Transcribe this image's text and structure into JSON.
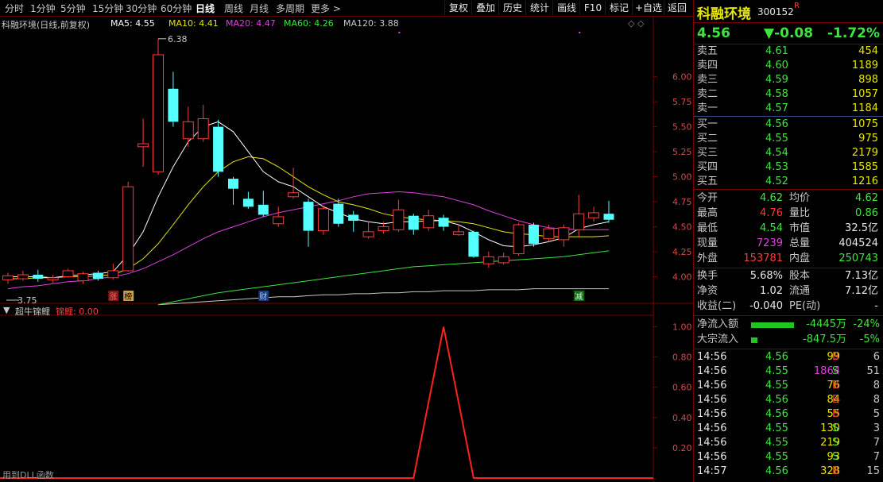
{
  "toolbar": {
    "periods": [
      "分时",
      "1分钟",
      "5分钟",
      "15分钟",
      "30分钟",
      "60分钟",
      "日线",
      "周线",
      "月线",
      "多周期",
      "更多 >"
    ],
    "active_period": "日线",
    "buttons": [
      "复权",
      "叠加",
      "历史",
      "统计",
      "画线",
      "F10",
      "标记",
      "+自选",
      "返回"
    ]
  },
  "main_chart": {
    "title": "科融环境(日线,前复权)",
    "ma": [
      {
        "label": "MA5: 4.55",
        "color": "#ffffff"
      },
      {
        "label": "MA10: 4.41",
        "color": "#e6e600"
      },
      {
        "label": "MA20: 4.47",
        "color": "#e040e0"
      },
      {
        "label": "MA60: 4.26",
        "color": "#3ce63c"
      },
      {
        "label": "MA120: 3.88",
        "color": "#c8c8c8"
      }
    ],
    "high_label": "6.38",
    "low_label": "3.75",
    "y_ticks": [
      "6.00",
      "5.75",
      "5.50",
      "5.25",
      "5.00",
      "4.75",
      "4.50",
      "4.25",
      "4.00"
    ],
    "markers": [
      "涨",
      "榜",
      "财",
      "减"
    ]
  },
  "chart_data": {
    "type": "candlestick",
    "ylim": [
      3.75,
      6.45
    ],
    "candles": [
      {
        "o": 3.97,
        "c": 4.01,
        "h": 4.04,
        "l": 3.93
      },
      {
        "o": 3.98,
        "c": 4.02,
        "h": 4.06,
        "l": 3.96
      },
      {
        "o": 4.02,
        "c": 3.98,
        "h": 4.07,
        "l": 3.95
      },
      {
        "o": 3.97,
        "c": 3.99,
        "h": 4.02,
        "l": 3.94
      },
      {
        "o": 4.0,
        "c": 4.06,
        "h": 4.08,
        "l": 3.99
      },
      {
        "o": 3.96,
        "c": 4.03,
        "h": 4.05,
        "l": 3.93
      },
      {
        "o": 4.04,
        "c": 3.98,
        "h": 4.06,
        "l": 3.96
      },
      {
        "o": 3.99,
        "c": 4.06,
        "h": 4.13,
        "l": 3.97
      },
      {
        "o": 4.06,
        "c": 4.9,
        "h": 4.95,
        "l": 4.05
      },
      {
        "o": 5.3,
        "c": 5.33,
        "h": 5.58,
        "l": 5.1
      },
      {
        "o": 5.05,
        "c": 6.22,
        "h": 6.38,
        "l": 5.02
      },
      {
        "o": 5.88,
        "c": 5.55,
        "h": 6.05,
        "l": 5.5
      },
      {
        "o": 5.38,
        "c": 5.55,
        "h": 5.7,
        "l": 5.3
      },
      {
        "o": 5.38,
        "c": 5.58,
        "h": 5.72,
        "l": 5.35
      },
      {
        "o": 5.5,
        "c": 5.05,
        "h": 5.57,
        "l": 5.0
      },
      {
        "o": 4.98,
        "c": 4.88,
        "h": 5.0,
        "l": 4.72
      },
      {
        "o": 4.78,
        "c": 4.7,
        "h": 4.85,
        "l": 4.68
      },
      {
        "o": 4.72,
        "c": 4.62,
        "h": 4.86,
        "l": 4.6
      },
      {
        "o": 4.53,
        "c": 4.6,
        "h": 4.7,
        "l": 4.5
      },
      {
        "o": 4.8,
        "c": 4.84,
        "h": 5.09,
        "l": 4.78
      },
      {
        "o": 4.75,
        "c": 4.46,
        "h": 4.78,
        "l": 4.3
      },
      {
        "o": 4.46,
        "c": 4.68,
        "h": 4.71,
        "l": 4.42
      },
      {
        "o": 4.73,
        "c": 4.53,
        "h": 4.78,
        "l": 4.5
      },
      {
        "o": 4.62,
        "c": 4.56,
        "h": 4.66,
        "l": 4.45
      },
      {
        "o": 4.4,
        "c": 4.45,
        "h": 4.55,
        "l": 4.38
      },
      {
        "o": 4.46,
        "c": 4.5,
        "h": 4.55,
        "l": 4.43
      },
      {
        "o": 4.47,
        "c": 4.67,
        "h": 4.77,
        "l": 4.45
      },
      {
        "o": 4.61,
        "c": 4.47,
        "h": 4.63,
        "l": 4.42
      },
      {
        "o": 4.49,
        "c": 4.61,
        "h": 4.67,
        "l": 4.46
      },
      {
        "o": 4.59,
        "c": 4.5,
        "h": 4.62,
        "l": 4.46
      },
      {
        "o": 4.42,
        "c": 4.45,
        "h": 4.52,
        "l": 4.41
      },
      {
        "o": 4.45,
        "c": 4.2,
        "h": 4.46,
        "l": 4.19
      },
      {
        "o": 4.13,
        "c": 4.2,
        "h": 4.25,
        "l": 4.09
      },
      {
        "o": 4.14,
        "c": 4.2,
        "h": 4.24,
        "l": 4.12
      },
      {
        "o": 4.23,
        "c": 4.52,
        "h": 4.54,
        "l": 4.21
      },
      {
        "o": 4.52,
        "c": 4.33,
        "h": 4.54,
        "l": 4.3
      },
      {
        "o": 4.38,
        "c": 4.48,
        "h": 4.52,
        "l": 4.35
      },
      {
        "o": 4.37,
        "c": 4.49,
        "h": 4.52,
        "l": 4.3
      },
      {
        "o": 4.47,
        "c": 4.63,
        "h": 4.82,
        "l": 4.4
      },
      {
        "o": 4.59,
        "c": 4.64,
        "h": 4.7,
        "l": 4.55
      },
      {
        "o": 4.63,
        "c": 4.57,
        "h": 4.76,
        "l": 4.54
      }
    ],
    "ma5": [
      4.0,
      4.0,
      4.0,
      3.99,
      4.01,
      4.02,
      4.03,
      4.05,
      4.22,
      4.45,
      4.8,
      5.1,
      5.35,
      5.5,
      5.55,
      5.45,
      5.25,
      5.05,
      4.95,
      4.9,
      4.8,
      4.7,
      4.64,
      4.58,
      4.55,
      4.53,
      4.55,
      4.55,
      4.56,
      4.56,
      4.52,
      4.45,
      4.37,
      4.31,
      4.3,
      4.32,
      4.35,
      4.39,
      4.48,
      4.52,
      4.55
    ],
    "ma10": [
      3.98,
      3.98,
      3.99,
      3.99,
      4.0,
      4.0,
      4.01,
      4.02,
      4.08,
      4.18,
      4.33,
      4.52,
      4.72,
      4.9,
      5.05,
      5.15,
      5.2,
      5.18,
      5.1,
      5.0,
      4.9,
      4.82,
      4.75,
      4.72,
      4.68,
      4.63,
      4.6,
      4.58,
      4.57,
      4.56,
      4.55,
      4.53,
      4.49,
      4.45,
      4.43,
      4.42,
      4.4,
      4.4,
      4.4,
      4.4,
      4.41
    ],
    "ma20": [
      3.88,
      3.9,
      3.91,
      3.93,
      3.95,
      3.96,
      3.98,
      4.0,
      4.03,
      4.08,
      4.15,
      4.22,
      4.3,
      4.38,
      4.45,
      4.5,
      4.55,
      4.6,
      4.64,
      4.67,
      4.7,
      4.73,
      4.76,
      4.8,
      4.83,
      4.84,
      4.85,
      4.84,
      4.82,
      4.8,
      4.76,
      4.72,
      4.66,
      4.61,
      4.56,
      4.52,
      4.49,
      4.48,
      4.47,
      4.47,
      4.47
    ],
    "ma60": [
      null,
      null,
      null,
      null,
      null,
      null,
      null,
      null,
      null,
      null,
      3.72,
      3.75,
      3.78,
      3.81,
      3.84,
      3.86,
      3.88,
      3.9,
      3.92,
      3.94,
      3.96,
      3.98,
      4.0,
      4.02,
      4.04,
      4.06,
      4.08,
      4.1,
      4.11,
      4.12,
      4.13,
      4.14,
      4.15,
      4.16,
      4.17,
      4.18,
      4.19,
      4.2,
      4.22,
      4.24,
      4.26
    ],
    "ma120": [
      null,
      null,
      null,
      null,
      null,
      null,
      null,
      null,
      null,
      null,
      3.72,
      3.73,
      3.74,
      3.75,
      3.76,
      3.77,
      3.78,
      3.79,
      3.8,
      3.8,
      3.81,
      3.82,
      3.82,
      3.83,
      3.83,
      3.84,
      3.84,
      3.85,
      3.85,
      3.86,
      3.86,
      3.86,
      3.87,
      3.87,
      3.87,
      3.88,
      3.88,
      3.88,
      3.88,
      3.88,
      3.88
    ]
  },
  "indicator": {
    "name": "超牛锦鲤",
    "value_label": "锦鲤: 0.00",
    "y_ticks": [
      "1.00",
      "0.80",
      "0.60",
      "0.40",
      "0.20"
    ],
    "footer": "用到DLL函数",
    "spike_index": 29,
    "ylim": [
      0,
      1.05
    ],
    "signal_start": 27,
    "signal_end": 31
  },
  "panel": {
    "name": "科融环境",
    "code": "300152",
    "badge": "R",
    "price": "4.56",
    "change": "▼-0.08",
    "change_pct": "-1.72%",
    "asks": [
      {
        "label": "卖五",
        "price": "4.61",
        "vol": "454"
      },
      {
        "label": "卖四",
        "price": "4.60",
        "vol": "1189"
      },
      {
        "label": "卖三",
        "price": "4.59",
        "vol": "898"
      },
      {
        "label": "卖二",
        "price": "4.58",
        "vol": "1057"
      },
      {
        "label": "卖一",
        "price": "4.57",
        "vol": "1184"
      }
    ],
    "bids": [
      {
        "label": "买一",
        "price": "4.56",
        "vol": "1075"
      },
      {
        "label": "买二",
        "price": "4.55",
        "vol": "975"
      },
      {
        "label": "买三",
        "price": "4.54",
        "vol": "2179"
      },
      {
        "label": "买四",
        "price": "4.53",
        "vol": "1585"
      },
      {
        "label": "买五",
        "price": "4.52",
        "vol": "1216"
      }
    ],
    "stats": [
      {
        "l1": "今开",
        "v1": "4.62",
        "c1": "green",
        "l2": "均价",
        "v2": "4.62",
        "c2": "green"
      },
      {
        "l1": "最高",
        "v1": "4.76",
        "c1": "red",
        "l2": "量比",
        "v2": "0.86",
        "c2": "green"
      },
      {
        "l1": "最低",
        "v1": "4.54",
        "c1": "green",
        "l2": "市值",
        "v2": "32.5亿",
        "c2": "white"
      },
      {
        "l1": "现量",
        "v1": "7239",
        "c1": "mag",
        "l2": "总量",
        "v2": "404524",
        "c2": "white"
      },
      {
        "l1": "外盘",
        "v1": "153781",
        "c1": "red",
        "l2": "内盘",
        "v2": "250743",
        "c2": "green"
      }
    ],
    "fund": [
      {
        "l1": "换手",
        "v1": "5.68%",
        "l2": "股本",
        "v2": "7.13亿"
      },
      {
        "l1": "净资",
        "v1": "1.02",
        "l2": "流通",
        "v2": "7.12亿"
      },
      {
        "l1": "收益(二)",
        "v1": "-0.040",
        "l2": "PE(动)",
        "v2": "-"
      }
    ],
    "flows": [
      {
        "label": "净流入额",
        "value": "-4445万",
        "pct": "-24%",
        "bar": 0.85
      },
      {
        "label": "大宗流入",
        "value": "-847.5万",
        "pct": "-5%",
        "bar": 0.12
      }
    ],
    "ticks": [
      {
        "t": "14:56",
        "p": "4.56",
        "v": "99",
        "d": "B",
        "n": "6"
      },
      {
        "t": "14:56",
        "p": "4.55",
        "v": "1864",
        "d": "S",
        "n": "51"
      },
      {
        "t": "14:56",
        "p": "4.55",
        "v": "76",
        "d": "B",
        "n": "8"
      },
      {
        "t": "14:56",
        "p": "4.56",
        "v": "84",
        "d": "B",
        "n": "8"
      },
      {
        "t": "14:56",
        "p": "4.56",
        "v": "55",
        "d": "B",
        "n": "5"
      },
      {
        "t": "14:56",
        "p": "4.55",
        "v": "130",
        "d": "S",
        "n": "3"
      },
      {
        "t": "14:56",
        "p": "4.55",
        "v": "219",
        "d": "S",
        "n": "7"
      },
      {
        "t": "14:56",
        "p": "4.55",
        "v": "93",
        "d": "S",
        "n": "7"
      },
      {
        "t": "14:57",
        "p": "4.56",
        "v": "328",
        "d": "B",
        "n": "15"
      }
    ]
  }
}
